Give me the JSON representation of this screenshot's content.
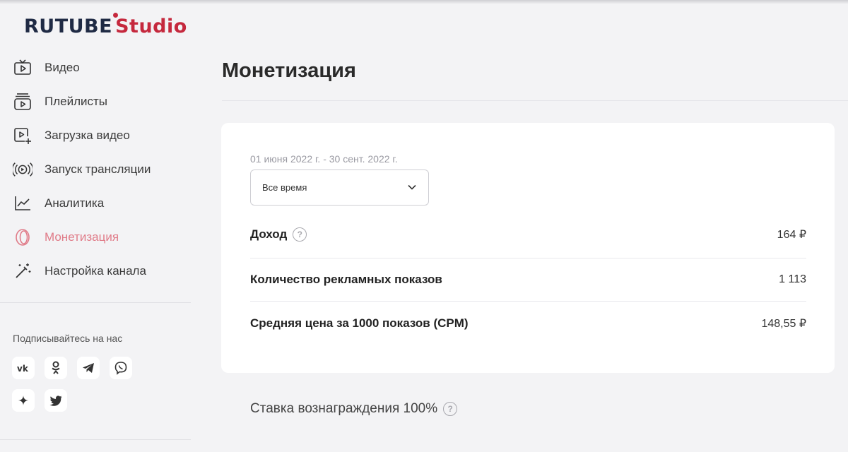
{
  "logo": {
    "brand": "RUTUBE",
    "studio": "Studio"
  },
  "sidebar": {
    "items": [
      {
        "label": "Видео",
        "icon": "tv-play-icon"
      },
      {
        "label": "Плейлисты",
        "icon": "playlist-icon"
      },
      {
        "label": "Загрузка видео",
        "icon": "upload-video-icon"
      },
      {
        "label": "Запуск трансляции",
        "icon": "broadcast-icon"
      },
      {
        "label": "Аналитика",
        "icon": "chart-line-icon"
      },
      {
        "label": "Монетизация",
        "icon": "coin-icon",
        "active": true
      },
      {
        "label": "Настройка канала",
        "icon": "magic-wand-icon"
      }
    ],
    "follow_label": "Подписывайтесь на нас",
    "socials": [
      {
        "label": "vk",
        "icon": "vk-icon"
      },
      {
        "label": "ok",
        "icon": "odnoklassniki-icon"
      },
      {
        "label": "telegram",
        "icon": "telegram-icon"
      },
      {
        "label": "viber",
        "icon": "viber-icon"
      },
      {
        "label": "zen",
        "icon": "zen-icon"
      },
      {
        "label": "twitter",
        "icon": "twitter-icon"
      }
    ]
  },
  "main": {
    "title": "Монетизация",
    "date_range": "01 июня 2022 г. - 30 сент. 2022 г.",
    "period_select": {
      "value": "Все время"
    },
    "stats": [
      {
        "label": "Доход",
        "value": "164 ₽",
        "help": true
      },
      {
        "label": "Количество рекламных показов",
        "value": "1 113"
      },
      {
        "label": "Средняя цена за 1000 показов (CPM)",
        "value": "148,55 ₽"
      }
    ],
    "reward_rate": "Ставка вознаграждения 100%"
  },
  "colors": {
    "accent": "#c5283d",
    "active_nav": "#e07b88",
    "brand_dark": "#1f2a44"
  }
}
